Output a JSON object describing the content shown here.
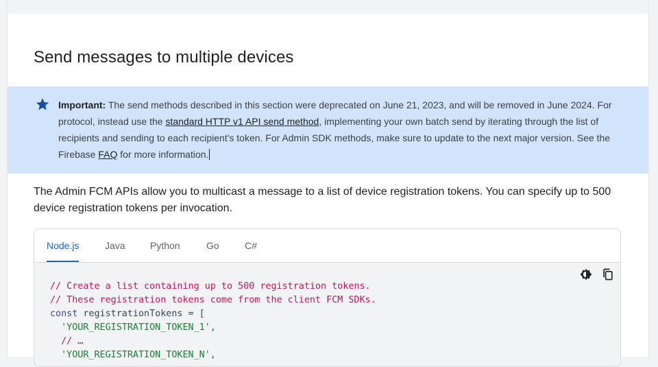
{
  "page": {
    "title": "Send messages to multiple devices"
  },
  "callout": {
    "label": "Important:",
    "text_1": " The send methods described in this section were deprecated on June 21, 2023, and will be removed in June 2024. For protocol, instead use the ",
    "link_1": "standard HTTP v1 API send method",
    "text_2": ", implementing your own batch send by iterating through the list of recipients and sending to each recipient's token. For Admin SDK methods, make sure to update to the next major version. See the Firebase ",
    "link_2": "FAQ",
    "text_3": " for more information.",
    "icon": "star-icon"
  },
  "intro": {
    "text": "The Admin FCM APIs allow you to multicast a message to a list of device registration tokens. You can specify up to 500 device registration tokens per invocation."
  },
  "code_tabs": {
    "items": [
      "Node.js",
      "Java",
      "Python",
      "Go",
      "C#"
    ],
    "active": "Node.js"
  },
  "code": {
    "line1": "// Create a list containing up to 500 registration tokens.",
    "line2": "// These registration tokens come from the client FCM SDKs.",
    "line3_kw": "const",
    "line3_rest": " registrationTokens = [",
    "line4": "  'YOUR_REGISTRATION_TOKEN_1',",
    "line5": "  // …",
    "line6": "  'YOUR_REGISTRATION_TOKEN_N',"
  },
  "colors": {
    "accent": "#1967d2",
    "callout_bg": "#d2e3fc",
    "star": "#174ea6",
    "comment": "#c2185b",
    "string": "#188038",
    "keyword": "#3949ab"
  }
}
